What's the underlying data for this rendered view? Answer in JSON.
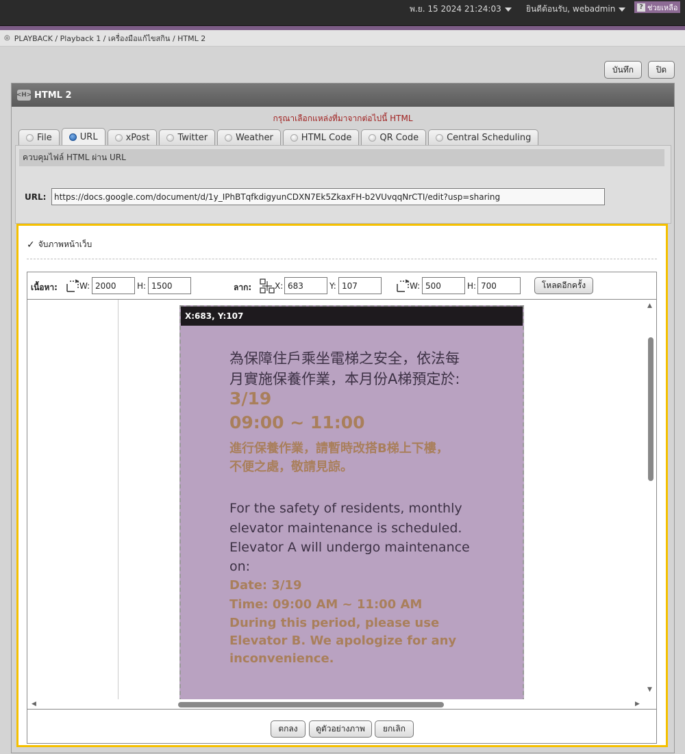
{
  "topbar": {
    "datetime": "พ.ย. 15 2024 21:24:03",
    "welcome": "ยินดีต้อนรับ, webadmin",
    "help": "ช่วยเหลือ"
  },
  "breadcrumb": "PLAYBACK / Playback 1 / เครื่องมือแก้ไขสกิน / HTML 2",
  "actions": {
    "save": "บันทึก",
    "close": "ปิด"
  },
  "panel": {
    "title": "HTML 2",
    "select_msg": "กรุณาเลือกแหล่งที่มาจากต่อไปนี้ HTML",
    "tabs": [
      "File",
      "URL",
      "xPost",
      "Twitter",
      "Weather",
      "HTML Code",
      "QR Code",
      "Central Scheduling"
    ],
    "active_tab": "URL",
    "section_title": "ควบคุมไฟล์ HTML ผ่าน URL",
    "url_label": "URL:",
    "url_value": "https://docs.google.com/document/d/1y_IPhBTqfkdigyunCDXN7Ek5ZkaxFH-b2VUvqqNrCTI/edit?usp=sharing"
  },
  "capture": {
    "checkbox_label": "จับภาพหน้าเว็บ",
    "content_label": "เนื้อหา:",
    "content_w_label": "W:",
    "content_w": "2000",
    "content_h_label": "H:",
    "content_h": "1500",
    "drag_label": "ลาก:",
    "drag_x_label": "X:",
    "drag_x": "683",
    "drag_y_label": "Y:",
    "drag_y": "107",
    "size_w_label": "W:",
    "size_w": "500",
    "size_h_label": "H:",
    "size_h": "700",
    "reload": "โหลดอีกครั้ง",
    "coord_text": "X:683, Y:107",
    "ok": "ตกลง",
    "preview_btn": "ดูตัวอย่างภาพ",
    "cancel": "ยกเลิก"
  },
  "preview": {
    "cn_line1": "為保障住戶乘坐電梯之安全，依法每",
    "cn_line2": "月實施保養作業，本月份A梯預定於:",
    "date": "3/19",
    "time": "09:00 ~ 11:00",
    "cn_bold1": "進行保養作業，請暫時改搭B梯上下樓，",
    "cn_bold2": "不便之處，敬請見諒。",
    "en_line1": "For the safety of residents, monthly",
    "en_line2": "elevator maintenance is scheduled.",
    "en_line3": "Elevator A will undergo maintenance",
    "en_line4": "on:",
    "en_date": "Date: 3/19",
    "en_time": "Time: 09:00 AM ~ 11:00 AM",
    "en_b1": "During this period, please use",
    "en_b2": "Elevator B. We apologize for any",
    "en_b3": "inconvenience."
  },
  "colors": {
    "accent_highlight": "#f5c000",
    "preview_bg": "#b9a2c1",
    "preview_accent": "#a97f5b",
    "header_purple": "#7c5c86"
  }
}
